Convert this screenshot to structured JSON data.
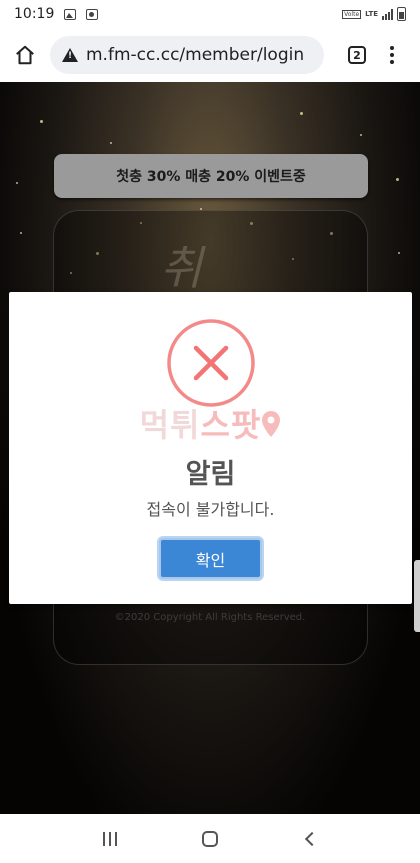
{
  "status_bar": {
    "time": "10:19",
    "volte_label": "Volte",
    "lte_label": "LTE"
  },
  "browser": {
    "url": "m.fm-cc.cc/member/login",
    "tab_count": "2",
    "icons": {
      "home": "home-icon",
      "security": "warning-icon",
      "menu": "more-vert-icon"
    }
  },
  "page": {
    "banner_text": "첫충 30% 매충 20% 이벤트중",
    "logo_text": "취",
    "copyright": "©2020 Copyright All Rights Reserved."
  },
  "modal": {
    "icon": "error-x-icon",
    "watermark_a": "먹튀",
    "watermark_b": "스팟",
    "title": "알림",
    "message": "접속이 불가합니다.",
    "confirm_label": "확인",
    "colors": {
      "error": "#f27474",
      "confirm_button": "#3b87d6"
    }
  },
  "nav": {
    "icons": [
      "recents-icon",
      "home-icon",
      "back-icon"
    ]
  }
}
